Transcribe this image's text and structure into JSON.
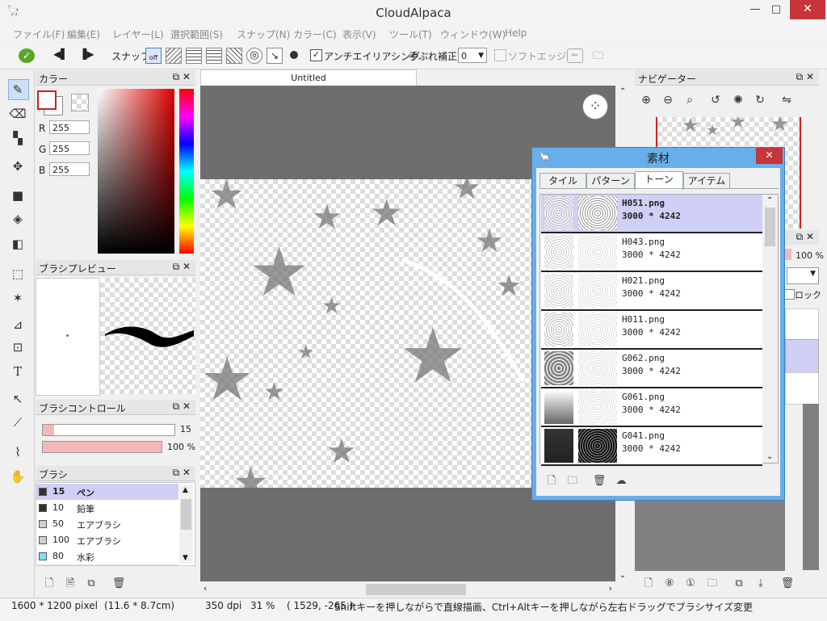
{
  "app": {
    "title": "CloudAlpaca"
  },
  "menu": [
    "ファイル(F)",
    "編集(E)",
    "レイヤー(L)",
    "選択範囲(S)",
    "スナップ(N)",
    "カラー(C)",
    "表示(V)",
    "ツール(T)",
    "ウィンドウ(W)",
    "Help"
  ],
  "toolbar": {
    "snap_label": "スナップ",
    "snap_off": "off",
    "antialias_label": "アンチエイリアシング",
    "antialias_checked": true,
    "stabilizer_label": "手ぶれ補正",
    "stabilizer_value": "0",
    "softedge_label": "ソフトエッジ"
  },
  "color_panel": {
    "title": "カラー",
    "r_label": "R",
    "g_label": "G",
    "b_label": "B",
    "r": "255",
    "g": "255",
    "b": "255",
    "primary": "#ffffff",
    "accent": "#d02020"
  },
  "brush_preview": {
    "title": "ブラシプレビュー"
  },
  "brush_control": {
    "title": "ブラシコントロール",
    "size": "15",
    "opacity": "100 %"
  },
  "brush_panel": {
    "title": "ブラシ",
    "items": [
      {
        "size": "15",
        "name": "ペン",
        "color": "#333333",
        "selected": true
      },
      {
        "size": "10",
        "name": "鉛筆",
        "color": "#333333",
        "selected": false
      },
      {
        "size": "50",
        "name": "エアブラシ",
        "color": "#cfcfcf",
        "selected": false
      },
      {
        "size": "100",
        "name": "エアブラシ",
        "color": "#cfcfcf",
        "selected": false
      },
      {
        "size": "80",
        "name": "水彩",
        "color": "#7ee0f5",
        "selected": false
      }
    ]
  },
  "canvas": {
    "tab": "Untitled"
  },
  "navigator": {
    "title": "ナビゲーター"
  },
  "layer_panel": {
    "opacity": "100 %",
    "lock_label": "ロック"
  },
  "material_dialog": {
    "title": "素材",
    "tabs": [
      "タイル",
      "パターン",
      "トーン",
      "アイテム"
    ],
    "active_tab": "トーン",
    "items": [
      {
        "name": "H051.png",
        "size": "3000 * 4242",
        "selected": true
      },
      {
        "name": "H043.png",
        "size": "3000 * 4242",
        "selected": false
      },
      {
        "name": "H021.png",
        "size": "3000 * 4242",
        "selected": false
      },
      {
        "name": "H011.png",
        "size": "3000 * 4242",
        "selected": false
      },
      {
        "name": "G062.png",
        "size": "3000 * 4242",
        "selected": false
      },
      {
        "name": "G061.png",
        "size": "3000 * 4242",
        "selected": false
      },
      {
        "name": "G041.png",
        "size": "3000 * 4242",
        "selected": false
      }
    ]
  },
  "status": {
    "dimensions": "1600 * 1200 pixel",
    "physical": "(11.6 * 8.7cm)",
    "dpi": "350 dpi",
    "zoom": "31 %",
    "cursor": "( 1529, -265 )",
    "hint": "Shiftキーを押しながらで直線描画、Ctrl+Altキーを押しながら左右ドラッグでブラシサイズ変更"
  }
}
